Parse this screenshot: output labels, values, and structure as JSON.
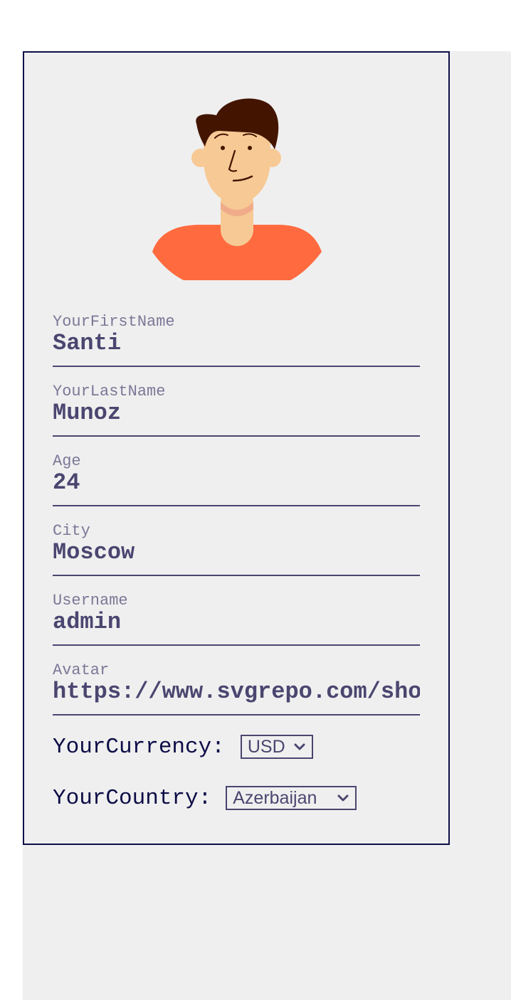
{
  "colors": {
    "page_background": "#efefef",
    "card_border": "#0d0d47",
    "label_text": "#7b7897",
    "value_text": "#4a4670",
    "avatar_shirt": "#ff6b3f",
    "avatar_skin": "#f7c995",
    "avatar_hair": "#431500"
  },
  "profile": {
    "avatar_icon": "male-avatar-icon",
    "fields": {
      "first_name": {
        "label": "YourFirstName",
        "value": "Santi"
      },
      "last_name": {
        "label": "YourLastName",
        "value": "Munoz"
      },
      "age": {
        "label": "Age",
        "value": "24"
      },
      "city": {
        "label": "City",
        "value": "Moscow"
      },
      "username": {
        "label": "Username",
        "value": "admin"
      },
      "avatar": {
        "label": "Avatar",
        "value": "https://www.svgrepo.com/sho"
      }
    },
    "currency": {
      "label": "YourCurrency:",
      "selected": "USD"
    },
    "country": {
      "label": "YourCountry:",
      "selected": "Azerbaijan"
    }
  }
}
